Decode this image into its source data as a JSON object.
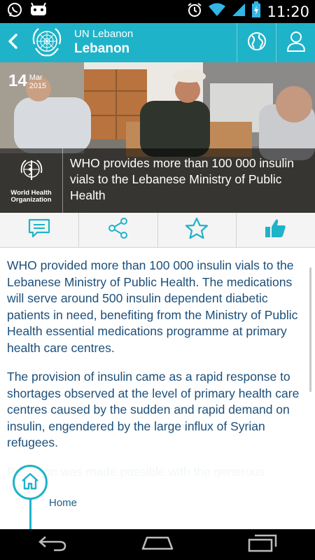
{
  "status_bar": {
    "time": "11:20",
    "left_icons": [
      "whatsapp-icon",
      "android-icon"
    ],
    "right_icons": [
      "alarm-icon",
      "wifi-icon",
      "signal-icon",
      "battery-icon"
    ]
  },
  "action_bar": {
    "subtitle": "UN Lebanon",
    "title": "Lebanon",
    "accent_color": "#1fb3c9",
    "icons": [
      "back-icon",
      "un-logo-icon",
      "globe-icon",
      "user-icon"
    ]
  },
  "article_header": {
    "date_day": "14",
    "date_month": "Mar",
    "date_year": "2015",
    "org_name": "World Health Organization",
    "headline": "WHO provides more than 100 000 insulin vials to the Lebanese Ministry of Public Health"
  },
  "share_bar": {
    "icons": [
      "comment-icon",
      "share-icon",
      "star-icon",
      "thumbs-up-icon"
    ]
  },
  "article_body": {
    "paragraphs": [
      "WHO provided more than 100 000 insulin vials to the Lebanese Ministry of Public Health. The medications will serve around 500 insulin dependent diabetic patients in need, benefiting from the Ministry of Public Health essential medications programme at primary health care centres.",
      "The provision of insulin came as a rapid response to shortages observed at the level of primary health care centres caused by the sudden and rapid demand on insulin, engendered by the large influx of Syrian refugees.",
      "Provision was made possible with the generous"
    ],
    "text_color": "#1c4f7a"
  },
  "home_nav": {
    "label": "Home"
  },
  "nav_bar": {
    "icons": [
      "nav-back-icon",
      "nav-home-icon",
      "nav-recents-icon"
    ]
  }
}
